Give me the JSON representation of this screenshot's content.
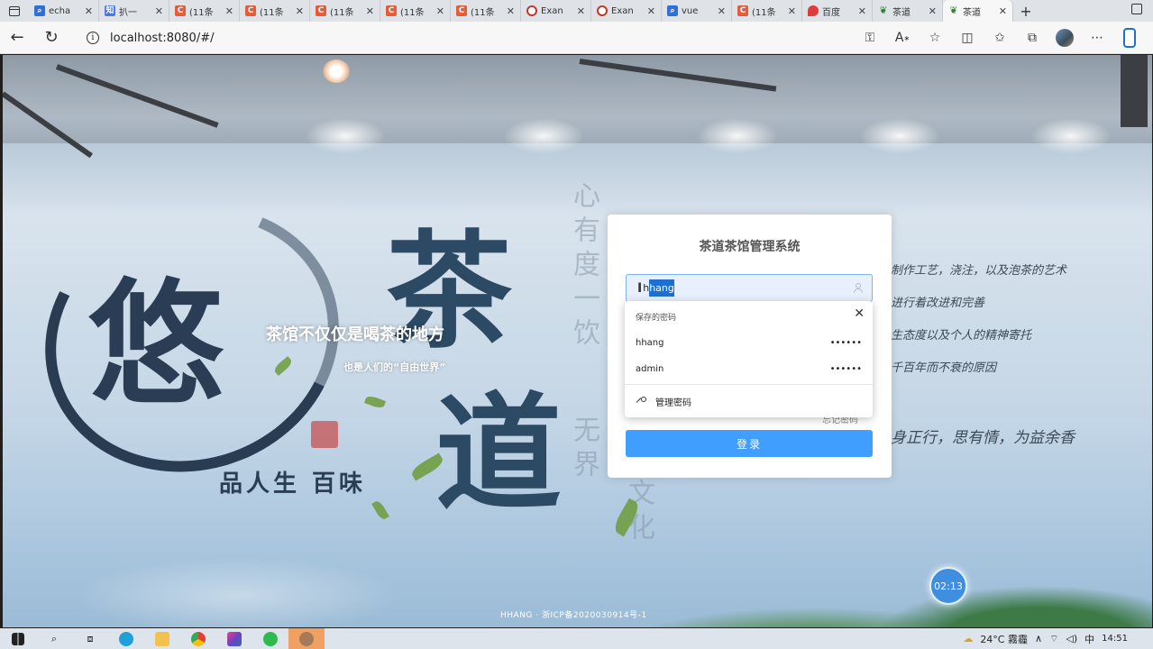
{
  "browser": {
    "tabs": [
      {
        "title": "echa",
        "favicon": "search-icon"
      },
      {
        "title": "扒一",
        "favicon": "zhihu-icon"
      },
      {
        "title": "(11条",
        "favicon": "csdn-icon"
      },
      {
        "title": "(11条",
        "favicon": "csdn-icon"
      },
      {
        "title": "(11条",
        "favicon": "csdn-icon"
      },
      {
        "title": "(11条",
        "favicon": "csdn-icon"
      },
      {
        "title": "(11条",
        "favicon": "csdn-icon"
      },
      {
        "title": "Exan",
        "favicon": "opera-icon"
      },
      {
        "title": "Exan",
        "favicon": "opera-icon"
      },
      {
        "title": "vue",
        "favicon": "search-icon"
      },
      {
        "title": "(11条",
        "favicon": "csdn-icon"
      },
      {
        "title": "百度",
        "favicon": "map-pin-icon"
      },
      {
        "title": "茶道",
        "favicon": "tea-icon"
      },
      {
        "title": "茶道",
        "favicon": "tea-icon",
        "active": true
      }
    ],
    "new_tab": "+",
    "url": "localhost:8080/#/"
  },
  "page": {
    "slogan_main": "茶馆不仅仅是喝茶的地方",
    "slogan_sub": "也是人们的“自由世界”",
    "brand_phrase": "品人生 百味",
    "bg_vertical_1": "心有度一饮",
    "bg_vertical_2": "无界",
    "bg_vertical_3": "文化",
    "big_char_1": "茶",
    "big_char_2": "道",
    "big_char_3": "悠",
    "verse_lines": [
      "制作工艺，浇注，以及泡茶的艺术",
      "进行着改进和完善",
      "生态度以及个人的精神寄托",
      "千百年而不衰的原因",
      "身正行，思有情，为益余香"
    ],
    "footer_icp": "HHANG · 浙ICP备2020030914号-1",
    "timer": "02:13"
  },
  "login": {
    "title": "茶道茶馆管理系统",
    "username_prefix": "h",
    "username_selected": "hang",
    "forgot": "忘记密码",
    "submit": "登录"
  },
  "password_popup": {
    "header": "保存的密码",
    "entries": [
      {
        "user": "hhang",
        "mask": "••••••"
      },
      {
        "user": "admin",
        "mask": "••••••"
      }
    ],
    "manage": "管理密码"
  },
  "taskbar": {
    "weather": "24°C 霧霾",
    "ime": "中",
    "time": "14:51"
  }
}
